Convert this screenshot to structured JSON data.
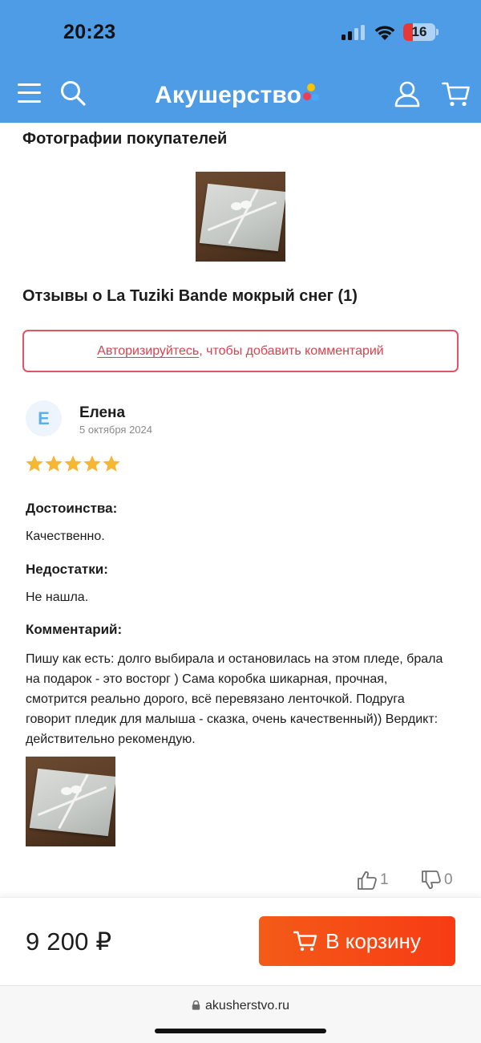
{
  "status_bar": {
    "time": "20:23",
    "battery_level": "16"
  },
  "header": {
    "logo_text": "Акушерство",
    "brand_dot_colors": [
      "#f6c400",
      "#ef3b56",
      "#4aa8ff"
    ]
  },
  "customer_photos": {
    "title": "Фотографии покупателей"
  },
  "reviews": {
    "title": "Отзывы о La Tuziki Bande мокрый снег (1)",
    "auth_link": "Авторизируйтесь",
    "auth_rest": ", чтобы добавить комментарий"
  },
  "review": {
    "avatar_letter": "Е",
    "author": "Елена",
    "date": "5 октября 2024",
    "rating": 5,
    "pros_label": "Достоинства:",
    "pros": "Качественно.",
    "cons_label": "Недостатки:",
    "cons": "Не нашла.",
    "comment_label": "Комментарий:",
    "comment": "Пишу как есть: долго выбирала и остановилась на этом пледе, брала на подарок - это восторг ) Сама коробка шикарная, прочная, смотрится реально дорого, всё перевязано ленточкой. Подруга говорит пледик для малыша - сказка, очень качественный)) Вердикт: действительно рекомендую.",
    "likes": "1",
    "dislikes": "0"
  },
  "purchase": {
    "price": "9 200 ₽",
    "cart_button": "В корзину"
  },
  "browser": {
    "url": "akusherstvo.ru"
  },
  "colors": {
    "header_bg": "#4e9be6",
    "accent_red": "#e25563",
    "cart_button": "#f45b18",
    "star": "#f5b731"
  }
}
